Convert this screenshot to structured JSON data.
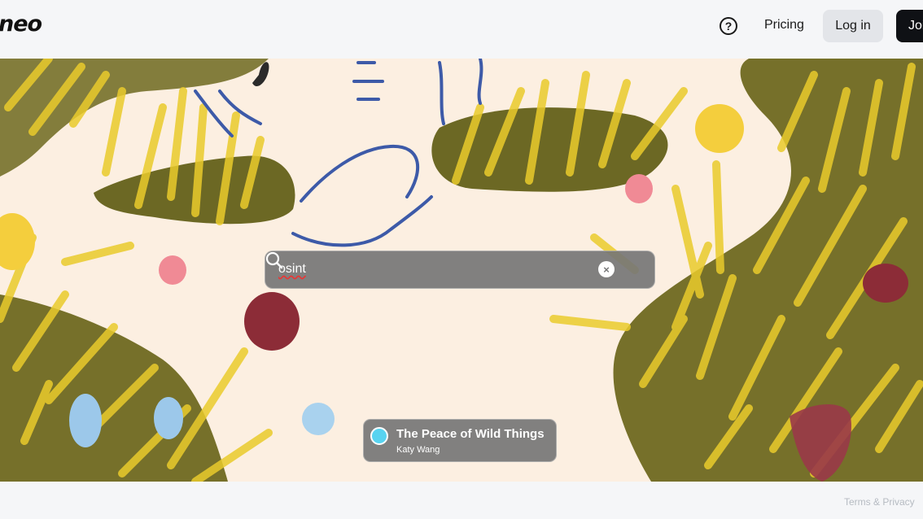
{
  "header": {
    "logo": "neo",
    "help_glyph": "?",
    "pricing_label": "Pricing",
    "login_label": "Log in",
    "join_label": "Join"
  },
  "search": {
    "value": "osint",
    "clear_glyph": "×"
  },
  "artwork": {
    "title": "The Peace of Wild Things",
    "author": "Katy Wang"
  },
  "footer": {
    "terms_label": "Terms & Privacy"
  },
  "colors": {
    "hero_background": "#fcefe1",
    "foliage": "#76702a",
    "grass": "#eacb2c",
    "button_dark": "#0f1115"
  }
}
